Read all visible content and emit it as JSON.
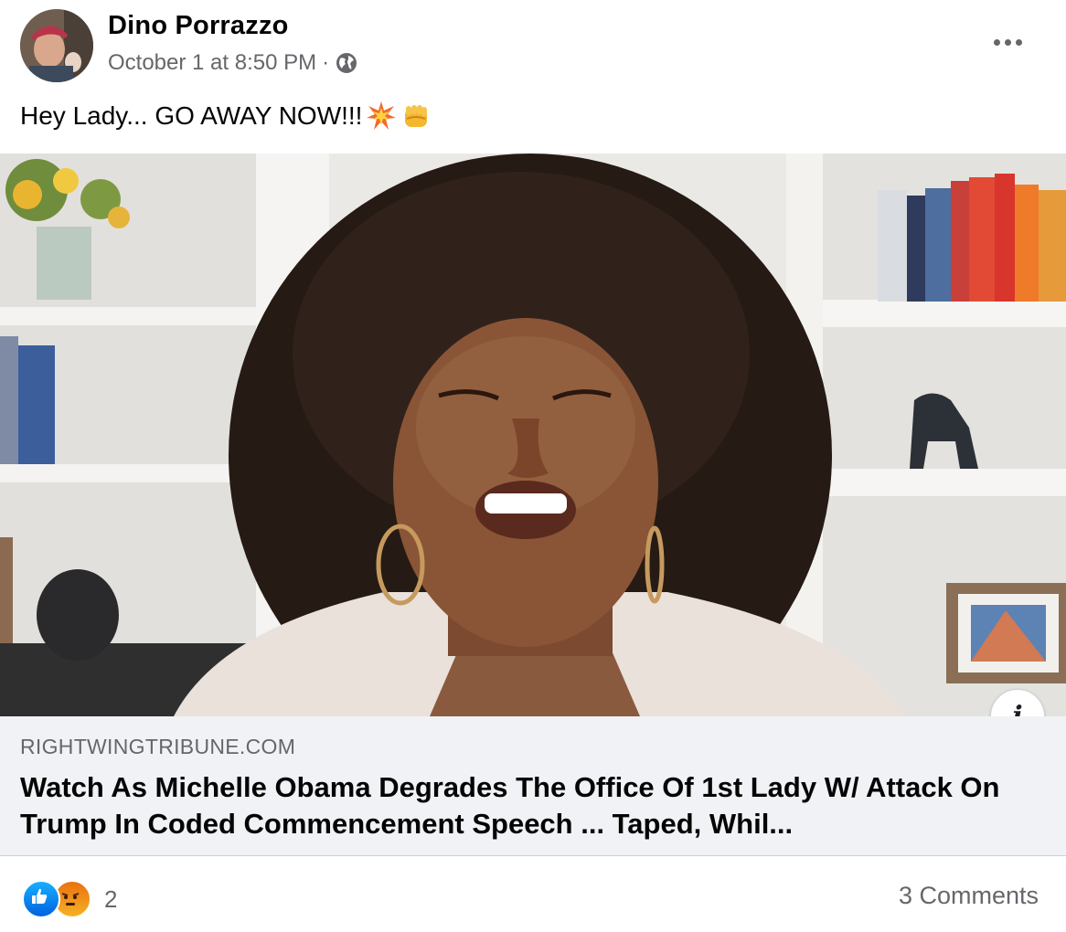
{
  "post": {
    "author": "Dino Porrazzo",
    "timestamp": "October 1 at 8:50 PM",
    "separator": "·",
    "privacy_icon": "globe-icon",
    "text": "Hey Lady... GO AWAY NOW!!!",
    "emojis": [
      "collision-emoji",
      "fist-emoji"
    ]
  },
  "link": {
    "domain": "RIGHTWINGTRIBUNE.COM",
    "title": "Watch As Michelle Obama Degrades The Office Of 1st Lady W/ Attack On Trump In Coded Commencement Speech ... Taped, Whil...",
    "info_label": "i"
  },
  "footer": {
    "reactions": [
      "like-reaction-icon",
      "angry-reaction-icon"
    ],
    "reaction_count": "2",
    "comments": "3 Comments"
  },
  "colors": {
    "secondary_text": "#65676b",
    "link_bg": "#f0f2f5",
    "like_blue": "#1877f2"
  }
}
